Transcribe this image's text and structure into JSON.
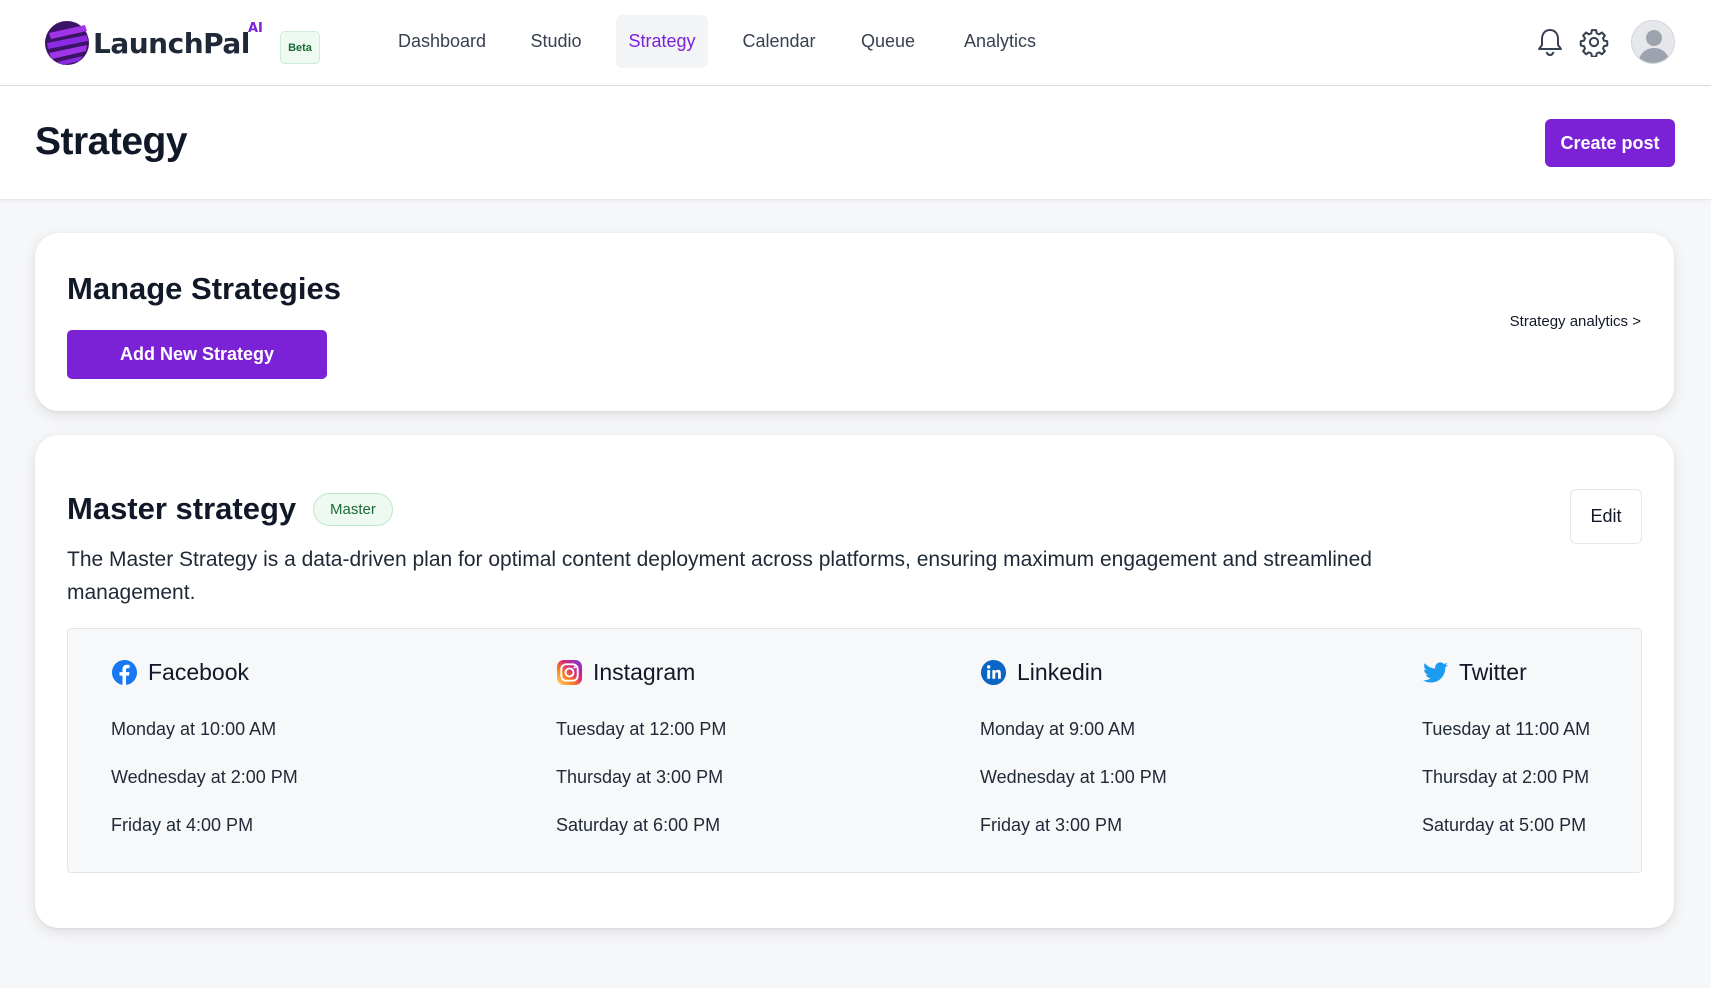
{
  "app": {
    "logo_text": "LaunchPal",
    "logo_superscript": "AI",
    "beta_label": "Beta",
    "brand_color": "#7c22d6"
  },
  "nav": {
    "items": [
      {
        "label": "Dashboard",
        "active": false
      },
      {
        "label": "Studio",
        "active": false
      },
      {
        "label": "Strategy",
        "active": true
      },
      {
        "label": "Calendar",
        "active": false
      },
      {
        "label": "Queue",
        "active": false
      },
      {
        "label": "Analytics",
        "active": false
      }
    ],
    "icons": [
      "bell-icon",
      "gear-icon",
      "avatar"
    ]
  },
  "page": {
    "title": "Strategy",
    "create_post_label": "Create post"
  },
  "manage": {
    "title": "Manage Strategies",
    "add_button_label": "Add New Strategy",
    "analytics_link_label": "Strategy analytics >"
  },
  "master": {
    "title": "Master strategy",
    "badge": "Master",
    "edit_label": "Edit",
    "description": "The Master Strategy is a data-driven plan for optimal content deployment across platforms, ensuring maximum engagement and streamlined management.",
    "platforms": [
      {
        "name": "Facebook",
        "icon": "facebook-icon",
        "color": "#1877f2",
        "slots": [
          "Monday at 10:00 AM",
          "Wednesday at 2:00 PM",
          "Friday at 4:00 PM"
        ]
      },
      {
        "name": "Instagram",
        "icon": "instagram-icon",
        "color": "#e1306c",
        "slots": [
          "Tuesday at 12:00 PM",
          "Thursday at 3:00 PM",
          "Saturday at 6:00 PM"
        ]
      },
      {
        "name": "Linkedin",
        "icon": "linkedin-icon",
        "color": "#0a66c2",
        "slots": [
          "Monday at 9:00 AM",
          "Wednesday at 1:00 PM",
          "Friday at 3:00 PM"
        ]
      },
      {
        "name": "Twitter",
        "icon": "twitter-icon",
        "color": "#1d9bf0",
        "slots": [
          "Tuesday at 11:00 AM",
          "Thursday at 2:00 PM",
          "Saturday at 5:00 PM"
        ]
      }
    ]
  }
}
